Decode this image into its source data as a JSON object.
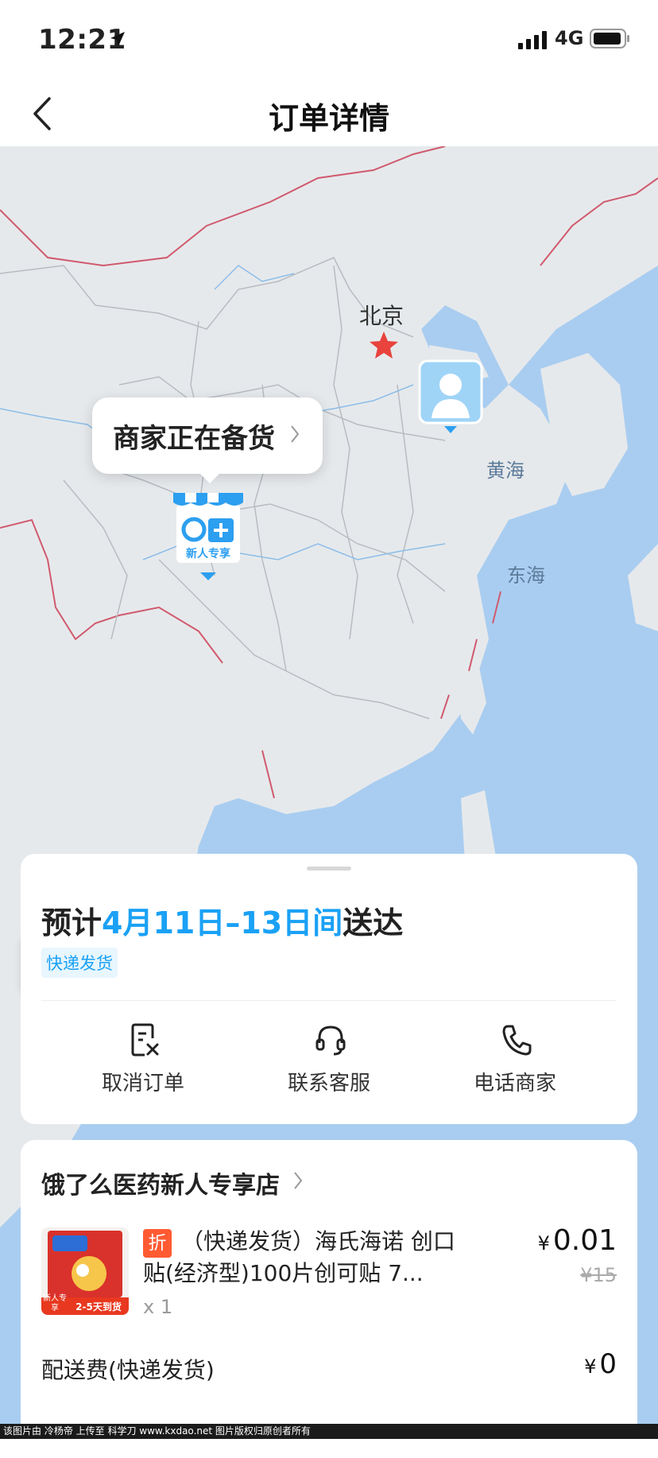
{
  "status_bar": {
    "time": "12:21",
    "network": "4G"
  },
  "header": {
    "title": "订单详情"
  },
  "map": {
    "labels": {
      "beijing": "北京",
      "yellow_sea": "黄海",
      "east_sea": "东海"
    },
    "callout": "商家正在备货",
    "store_marker_text": "新人专享",
    "colors": {
      "land": "#e6e9ec",
      "sea": "#a9cdf0",
      "border": "#d05a6e",
      "province": "#b8bcc2",
      "river": "#8cbde8"
    }
  },
  "delivery": {
    "eta_prefix": "预计",
    "eta_range": "4月11日–13日间",
    "eta_suffix": "送达",
    "ship_tag": "快递发货",
    "actions": [
      {
        "label": "取消订单",
        "icon": "cancel-order-icon"
      },
      {
        "label": "联系客服",
        "icon": "headset-icon"
      },
      {
        "label": "电话商家",
        "icon": "phone-icon"
      }
    ]
  },
  "order": {
    "shop_name": "饿了么医药新人专享店",
    "item": {
      "discount_badge": "折",
      "title": "（快递发货）海氏海诺 创口贴(经济型)100片创可贴 7...",
      "qty": "x 1",
      "currency": "¥",
      "price": "0.01",
      "original_price": "¥15",
      "image_badge_left": "新人专享",
      "image_badge_right": "2-5天到货"
    },
    "shipping_fee_label": "配送费(快递发货)",
    "shipping_fee_value": "0"
  },
  "watermark": "该图片由 冷杨帝 上传至 科学刀 www.kxdao.net 图片版权归原创者所有",
  "accent_color": "#1aa1f5"
}
